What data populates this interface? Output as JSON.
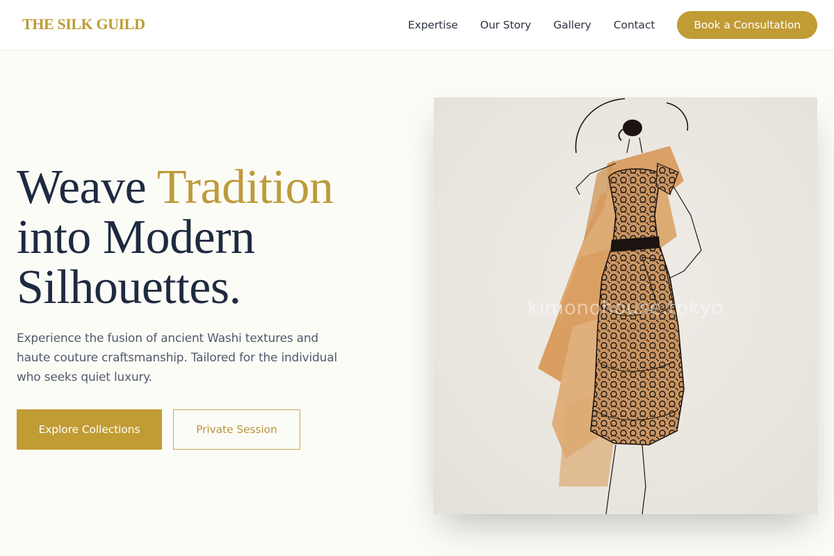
{
  "brand": {
    "name": "THE SILK GUILD",
    "accent_color": "#c19b34",
    "text_color": "#1e2a3f"
  },
  "nav": {
    "links": [
      "Expertise",
      "Our Story",
      "Gallery",
      "Contact"
    ],
    "cta_label": "Book a Consultation"
  },
  "hero": {
    "title_part1": "Weave ",
    "title_accent": "Tradition",
    "title_line2": "into Modern",
    "title_line3": "Silhouettes.",
    "subtitle": "Experience the fusion of ancient Washi textures and haute couture craftsmanship. Tailored for the individual who seeks quiet luxury.",
    "primary_button": "Explore Collections",
    "secondary_button": "Private Session"
  },
  "image": {
    "watermark": "kimonohouse.tokyo",
    "subject": "fashion-sketch-illustration"
  }
}
